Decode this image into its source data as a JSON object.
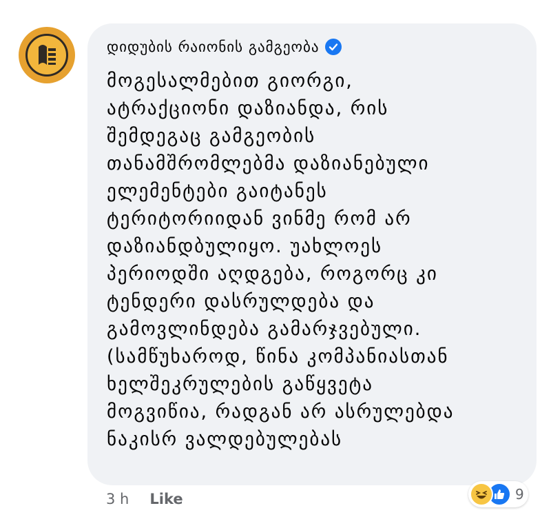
{
  "comment": {
    "author": "დიდუბის რაიონის გამგეობა",
    "verified_icon": "verified-badge-icon",
    "avatar_icon": "organization-logo-icon",
    "message_lines": [
      "მოგესალმებით გიორგი,",
      "ატრაქციონი დაზიანდა, რის",
      "შემდეგაც გამგეობის",
      "თანამშრომლებმა დაზიანებული",
      "ელემენტები გაიტანეს",
      "ტერიტორიიდან ვინმე რომ არ",
      "დაზიანდბულიყო. უახლოეს",
      "პერიოდში აღდგება, როგორც კი",
      "ტენდერი დასრულდება და",
      "გამოვლინდება გამარჯვებული.",
      "(სამწუხაროდ, წინა კომპანიასთან",
      "ხელშეკრულების გაწყვეტა",
      "მოგვიწია, რადგან არ ასრულებდა",
      "ნაკისრ ვალდებულებას"
    ],
    "timestamp": "3 h",
    "like_label": "Like",
    "reactions": {
      "icons": [
        "haha-reaction-icon",
        "like-reaction-icon"
      ],
      "count": "9"
    }
  },
  "colors": {
    "bubble_bg": "#f0f2f5",
    "verified_blue": "#1877f2",
    "avatar_orange": "#e6a12f",
    "meta_gray": "#65676b"
  }
}
